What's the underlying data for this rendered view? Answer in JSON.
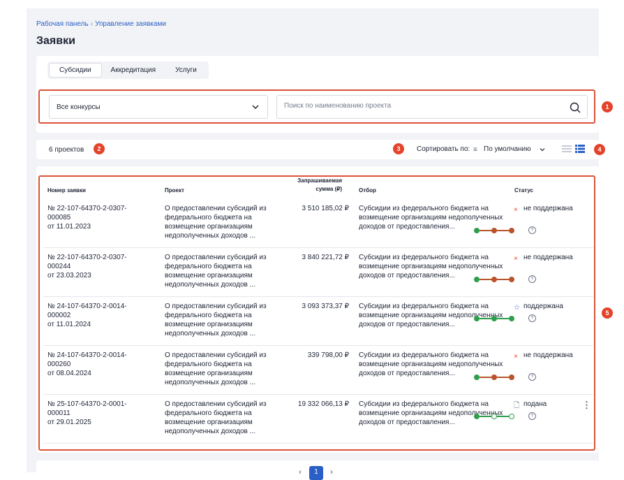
{
  "breadcrumb": {
    "items": [
      "Рабочая панель",
      "Управление заявками"
    ],
    "separator": "›"
  },
  "page_title": "Заявки",
  "tabs": [
    {
      "label": "Субсидии",
      "active": true
    },
    {
      "label": "Аккредитация",
      "active": false
    },
    {
      "label": "Услуги",
      "active": false
    }
  ],
  "filters": {
    "contest_select": "Все конкурсы",
    "search_placeholder": "Поиск по наименованию проекта"
  },
  "summary": {
    "count_text": "6 проектов",
    "sort_label": "Сортировать по:",
    "sort_value": "По умолчанию"
  },
  "annotations": [
    "1",
    "2",
    "3",
    "4",
    "5"
  ],
  "table": {
    "headers": {
      "number": "Номер заявки",
      "project": "Проект",
      "sum_line1": "Запрашиваемая",
      "sum_line2": "сумма (₽)",
      "selection": "Отбор",
      "status": "Статус"
    },
    "rows": [
      {
        "num1": "№ 22-107-64370-2-0307-",
        "num2": "000085",
        "date": "от 11.01.2023",
        "project": "О предоставлении субсидий из федерального бюджета на возмещение организациям недополученных доходов ...",
        "sum": "3 510 185,02 ₽",
        "selection": "Субсидии из федерального бюджета на возмещение организациям недополученных доходов от предоставления...",
        "status": "не поддержана",
        "status_icon": "x-icon",
        "steps": [
          "#2e9e4a",
          "#b8532b",
          "#b8532b"
        ]
      },
      {
        "num1": "№ 22-107-64370-2-0307-",
        "num2": "000244",
        "date": "от 23.03.2023",
        "project": "О предоставлении субсидий из федерального бюджета на возмещение организациям недополученных доходов ...",
        "sum": "3 840 221,72 ₽",
        "selection": "Субсидии из федерального бюджета на возмещение организациям недополученных доходов от предоставления...",
        "status": "не поддержана",
        "status_icon": "x-icon",
        "steps": [
          "#2e9e4a",
          "#b8532b",
          "#b8532b"
        ]
      },
      {
        "num1": "№ 24-107-64370-2-0014-",
        "num2": "000002",
        "date": "от 11.01.2024",
        "project": "О предоставлении субсидий из федерального бюджета на возмещение организациям недополученных доходов ...",
        "sum": "3 093 373,37 ₽",
        "selection": "Субсидии из федерального бюджета на возмещение организациям недополученных доходов от предоставления...",
        "status": "поддержана",
        "status_icon": "star-icon",
        "steps": [
          "#2e9e4a",
          "#2e9e4a",
          "#2e9e4a"
        ]
      },
      {
        "num1": "№ 24-107-64370-2-0014-",
        "num2": "000260",
        "date": "от 08.04.2024",
        "project": "О предоставлении субсидий из федерального бюджета на возмещение организациям недополученных доходов ...",
        "sum": "339 798,00 ₽",
        "selection": "Субсидии из федерального бюджета на возмещение организациям недополученных доходов от предоставления...",
        "status": "не поддержана",
        "status_icon": "x-icon",
        "steps": [
          "#2e9e4a",
          "#b8532b",
          "#b8532b"
        ]
      },
      {
        "num1": "№ 25-107-64370-2-0001-",
        "num2": "000011",
        "date": "от 29.01.2025",
        "project": "О предоставлении субсидий из федерального бюджета на возмещение организациям недополученных доходов ...",
        "sum": "19 332 066,13 ₽",
        "selection": "Субсидии из федерального бюджета на возмещение организациям недополученных доходов от предоставления...",
        "status": "подана",
        "status_icon": "document-icon",
        "steps": [
          "#2e9e4a",
          "hollow",
          "hollow"
        ]
      }
    ]
  },
  "pagination": {
    "current": "1",
    "prev": "‹",
    "next": "›"
  },
  "colors": {
    "accent": "#2a5fc7",
    "highlight": "#dc5238",
    "success": "#2e9e4a",
    "rejected": "#b8532b"
  }
}
